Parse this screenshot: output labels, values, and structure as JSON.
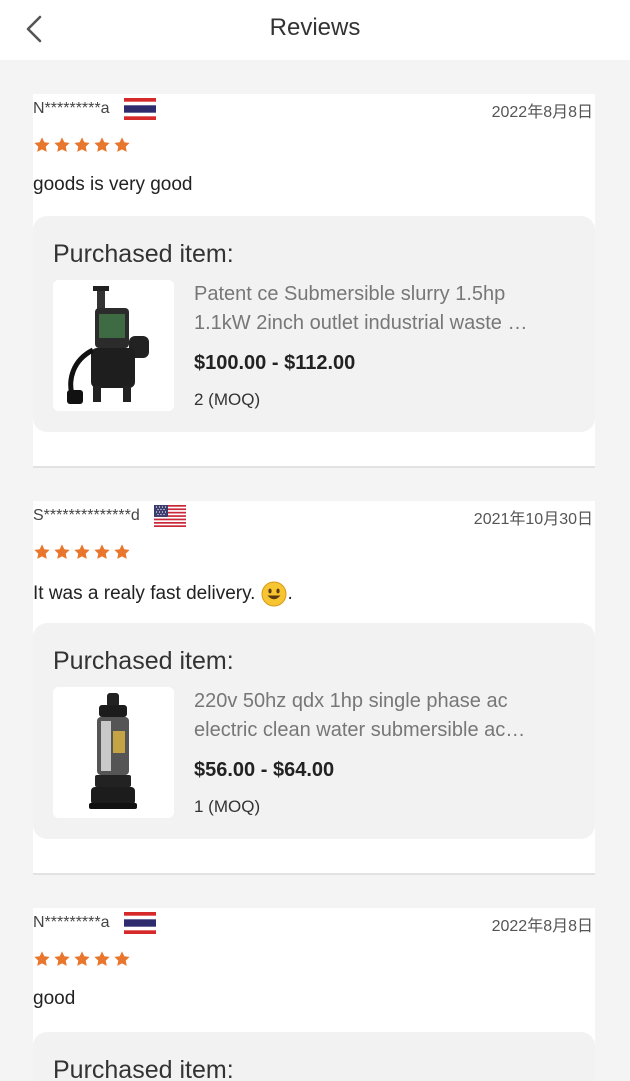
{
  "header": {
    "title": "Reviews"
  },
  "reviews": [
    {
      "reviewer": "N*********a",
      "flag": "thailand-flag",
      "date": "2022年8月8日",
      "rating": 5,
      "comment": "goods is very good",
      "comment_suffix": "",
      "purchase_label": "Purchased item:",
      "product_line1": "Patent ce Submersible slurry 1.5hp",
      "product_line2": "1.1kW 2inch outlet industrial waste …",
      "price": "$100.00 - $112.00",
      "moq": "2 (MOQ)"
    },
    {
      "reviewer": "S**************d",
      "flag": "usa-flag",
      "date": "2021年10月30日",
      "rating": 5,
      "comment": "It was a realy fast delivery.",
      "comment_suffix": ".",
      "purchase_label": "Purchased item:",
      "product_line1": "220v 50hz qdx 1hp single phase ac",
      "product_line2": "electric clean water submersible ac…",
      "price": "$56.00 - $64.00",
      "moq": "1 (MOQ)"
    },
    {
      "reviewer": "N*********a",
      "flag": "thailand-flag",
      "date": "2022年8月8日",
      "rating": 5,
      "comment": "good",
      "comment_suffix": "",
      "purchase_label": "Purchased item:"
    }
  ],
  "colors": {
    "star": "#e8762d",
    "background": "#f4f4f4",
    "card": "#ffffff",
    "purchase_box": "#f2f2f2"
  }
}
